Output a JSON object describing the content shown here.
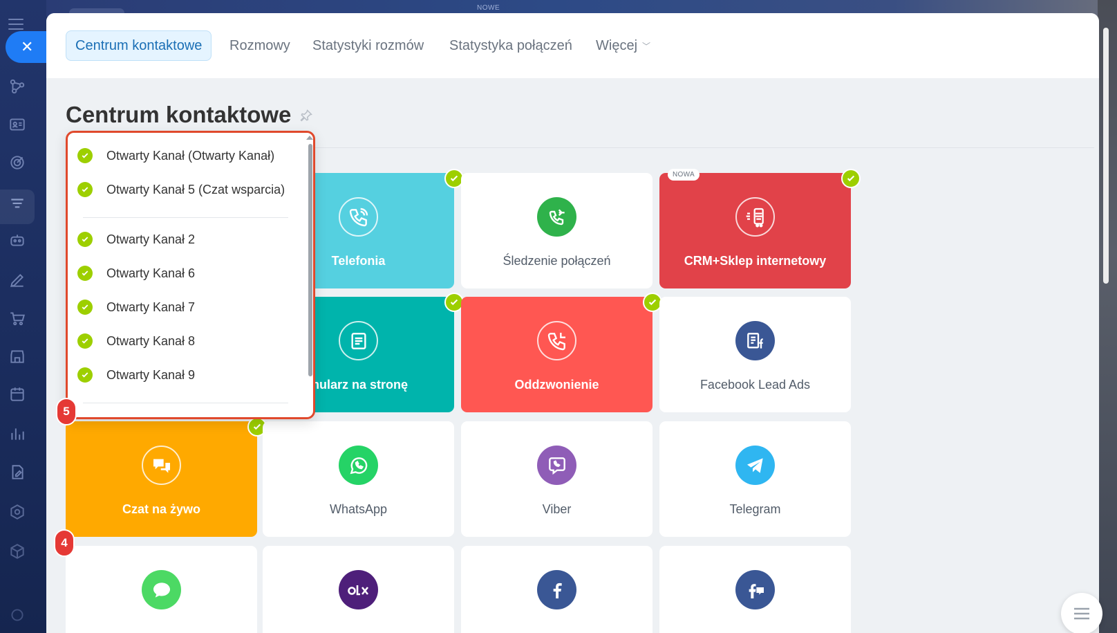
{
  "background": {
    "top_label": "NOWE"
  },
  "tabs": [
    {
      "label": "Centrum kontaktowe",
      "active": true
    },
    {
      "label": "Rozmowy"
    },
    {
      "label": "Statystyki rozmów"
    },
    {
      "label": "Statystyka połączeń"
    },
    {
      "label": "Więcej"
    }
  ],
  "page": {
    "title": "Centrum kontaktowe"
  },
  "popup": {
    "items": [
      {
        "label": "Otwarty Kanał (Otwarty Kanał)"
      },
      {
        "label": "Otwarty Kanał 5 (Czat wsparcia)"
      },
      {
        "label": "Otwarty Kanał 2"
      },
      {
        "label": "Otwarty Kanał 6"
      },
      {
        "label": "Otwarty Kanał 7"
      },
      {
        "label": "Otwarty Kanał 8"
      },
      {
        "label": "Otwarty Kanał 9"
      }
    ]
  },
  "tiles": {
    "telefonia": {
      "label": "Telefonia",
      "color": "#55d0e0",
      "checked": true,
      "icon": "phone-icon"
    },
    "sledzenie": {
      "label": "Śledzenie połączeń",
      "color": "#ffffff",
      "icon_color": "#2fb24b",
      "icon": "call-tracking-icon"
    },
    "crm_shop": {
      "label": "CRM+Sklep internetowy",
      "color": "#e14249",
      "checked": true,
      "badge": "NOWA",
      "icon": "shopping-cart-icon"
    },
    "formularz": {
      "label": "Formularz na stronę",
      "color": "#00b4ac",
      "checked": true,
      "icon": "form-icon"
    },
    "oddzwonienie": {
      "label": "Oddzwonienie",
      "color": "#ff5752",
      "checked": true,
      "icon": "callback-icon"
    },
    "facebook_lead": {
      "label": "Facebook Lead Ads",
      "color": "#ffffff",
      "icon_color": "#3a5795",
      "icon": "facebook-lead-ads-icon"
    },
    "czat": {
      "label": "Czat na żywo",
      "color": "#ffa900",
      "checked": true,
      "icon": "chat-icon"
    },
    "whatsapp": {
      "label": "WhatsApp",
      "color": "#ffffff",
      "icon_color": "#25d366",
      "icon": "whatsapp-icon"
    },
    "viber": {
      "label": "Viber",
      "color": "#ffffff",
      "icon_color": "#8f5db7",
      "icon": "viber-icon"
    },
    "telegram": {
      "label": "Telegram",
      "color": "#ffffff",
      "icon_color": "#2fb6f1",
      "icon": "telegram-icon"
    },
    "imessage": {
      "icon_color": "#4cd964",
      "icon": "message-icon"
    },
    "olx": {
      "icon_color": "#4e1f7a",
      "icon": "olx-icon"
    },
    "facebook": {
      "icon_color": "#3a5795",
      "icon": "facebook-icon"
    },
    "fb_comments": {
      "icon_color": "#3a5795",
      "icon": "facebook-comments-icon"
    }
  },
  "steps": {
    "popup_step": "5",
    "tile_step": "4"
  },
  "colors": {
    "accent": "#1f7cf5",
    "check": "#9dcf00",
    "highlight": "#e0492c",
    "step_badge": "#e53935"
  }
}
